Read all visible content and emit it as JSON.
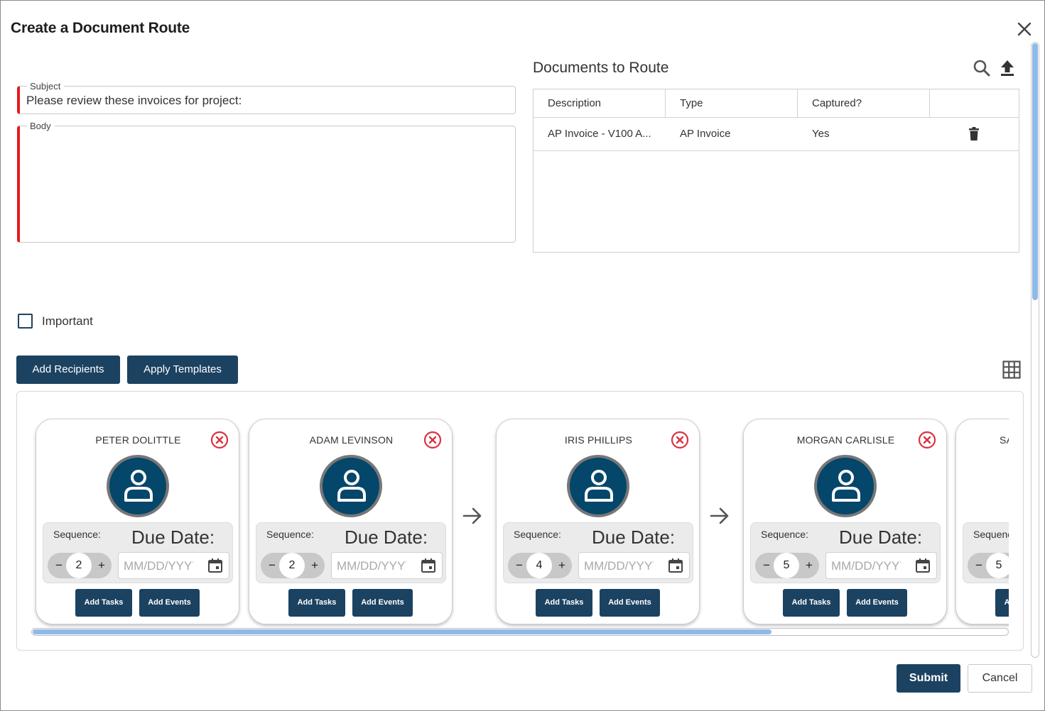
{
  "dialog": {
    "title": "Create a Document Route",
    "close_icon": "close-icon"
  },
  "form": {
    "subject_label": "Subject",
    "subject_value": "Please review these invoices for project:",
    "body_label": "Body",
    "body_value": "",
    "important_label": "Important",
    "important_checked": false,
    "required_indicator_color": "#e41b1b"
  },
  "documents": {
    "title": "Documents to Route",
    "icons": [
      "search-icon",
      "upload-icon",
      "trash-icon"
    ],
    "columns": [
      "Description",
      "Type",
      "Captured?",
      ""
    ],
    "rows": [
      {
        "description": "AP Invoice - V100 A...",
        "type": "AP Invoice",
        "captured": "Yes"
      }
    ]
  },
  "actions": {
    "add_recipients": "Add Recipients",
    "apply_templates": "Apply Templates",
    "grid_view_icon": "grid-view-icon"
  },
  "recipients": {
    "sequence_label": "Sequence:",
    "due_date_label": "Due Date:",
    "date_placeholder": "MM/DD/YYYY",
    "add_tasks_label": "Add Tasks",
    "add_events_label": "Add Events",
    "minus": "−",
    "plus": "+",
    "cards": [
      {
        "name": "PETER DOLITTLE",
        "sequence": "2"
      },
      {
        "name": "ADAM LEVINSON",
        "sequence": "2"
      },
      {
        "name": "IRIS PHILLIPS",
        "sequence": "4"
      },
      {
        "name": "MORGAN CARLISLE",
        "sequence": "5"
      },
      {
        "name": "SA",
        "sequence": "5"
      }
    ],
    "horizontal_scroll_fraction": 0.76
  },
  "footer": {
    "submit": "Submit",
    "cancel": "Cancel"
  },
  "colors": {
    "primary": "#1c4261",
    "avatar": "#05466b",
    "remove": "#d9333f",
    "scroll_thumb": "#8fb9e8"
  }
}
